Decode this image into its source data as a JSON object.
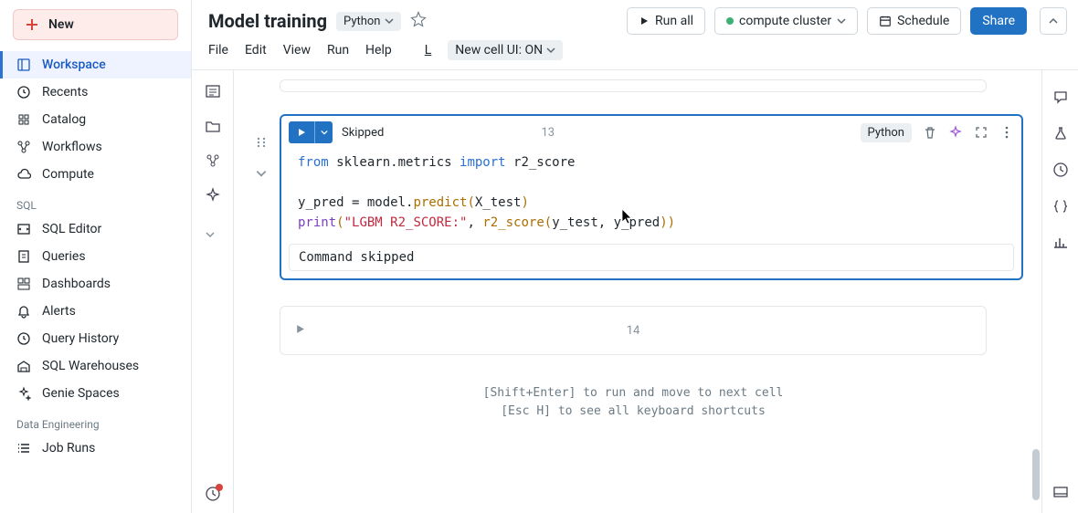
{
  "sidebar": {
    "new_label": "New",
    "groups": [
      {
        "items": [
          {
            "id": "workspace",
            "icon": "book-icon",
            "label": "Workspace",
            "active": true
          },
          {
            "id": "recents",
            "icon": "clock-icon",
            "label": "Recents"
          },
          {
            "id": "catalog",
            "icon": "catalog-icon",
            "label": "Catalog"
          },
          {
            "id": "workflows",
            "icon": "workflow-icon",
            "label": "Workflows"
          },
          {
            "id": "compute",
            "icon": "cloud-icon",
            "label": "Compute"
          }
        ]
      },
      {
        "label": "SQL",
        "items": [
          {
            "id": "sqleditor",
            "icon": "sqleditor-icon",
            "label": "SQL Editor"
          },
          {
            "id": "queries",
            "icon": "queries-icon",
            "label": "Queries"
          },
          {
            "id": "dashboards",
            "icon": "dashboard-icon",
            "label": "Dashboards"
          },
          {
            "id": "alerts",
            "icon": "bell-icon",
            "label": "Alerts"
          },
          {
            "id": "qhistory",
            "icon": "clock-icon",
            "label": "Query History"
          },
          {
            "id": "sqlwh",
            "icon": "warehouse-icon",
            "label": "SQL Warehouses"
          },
          {
            "id": "genie",
            "icon": "sparkle-icon",
            "label": "Genie Spaces"
          }
        ]
      },
      {
        "label": "Data Engineering",
        "items": [
          {
            "id": "jobruns",
            "icon": "list-icon",
            "label": "Job Runs"
          }
        ]
      }
    ]
  },
  "header": {
    "title": "Model training",
    "language": "Python",
    "menus": [
      "File",
      "Edit",
      "View",
      "Run",
      "Help"
    ],
    "last_edit": "L",
    "new_cell_toggle": "New cell UI: ON",
    "run_all": "Run all",
    "compute": "compute cluster",
    "schedule": "Schedule",
    "share": "Share"
  },
  "left_rail": {
    "items": [
      "toc-icon",
      "folder-icon",
      "variables-icon",
      "assist-icon"
    ],
    "bottom": "history-icon"
  },
  "right_rail": {
    "items": [
      "comment-icon",
      "flask-icon",
      "history-icon",
      "braces-icon",
      "chart-icon"
    ],
    "bottom": "panel-icon"
  },
  "cell13": {
    "number": "13",
    "status": "Skipped",
    "lang": "Python",
    "output": "Command skipped",
    "code_plain": "from sklearn.metrics import r2_score\n\ny_pred = model.predict(X_test)\nprint(\"LGBM R2_SCORE:\", r2_score(y_test, y_pred))"
  },
  "cell14": {
    "number": "14"
  },
  "hints": {
    "line1": "[Shift+Enter] to run and move to next cell",
    "line2": "[Esc H] to see all keyboard shortcuts"
  }
}
